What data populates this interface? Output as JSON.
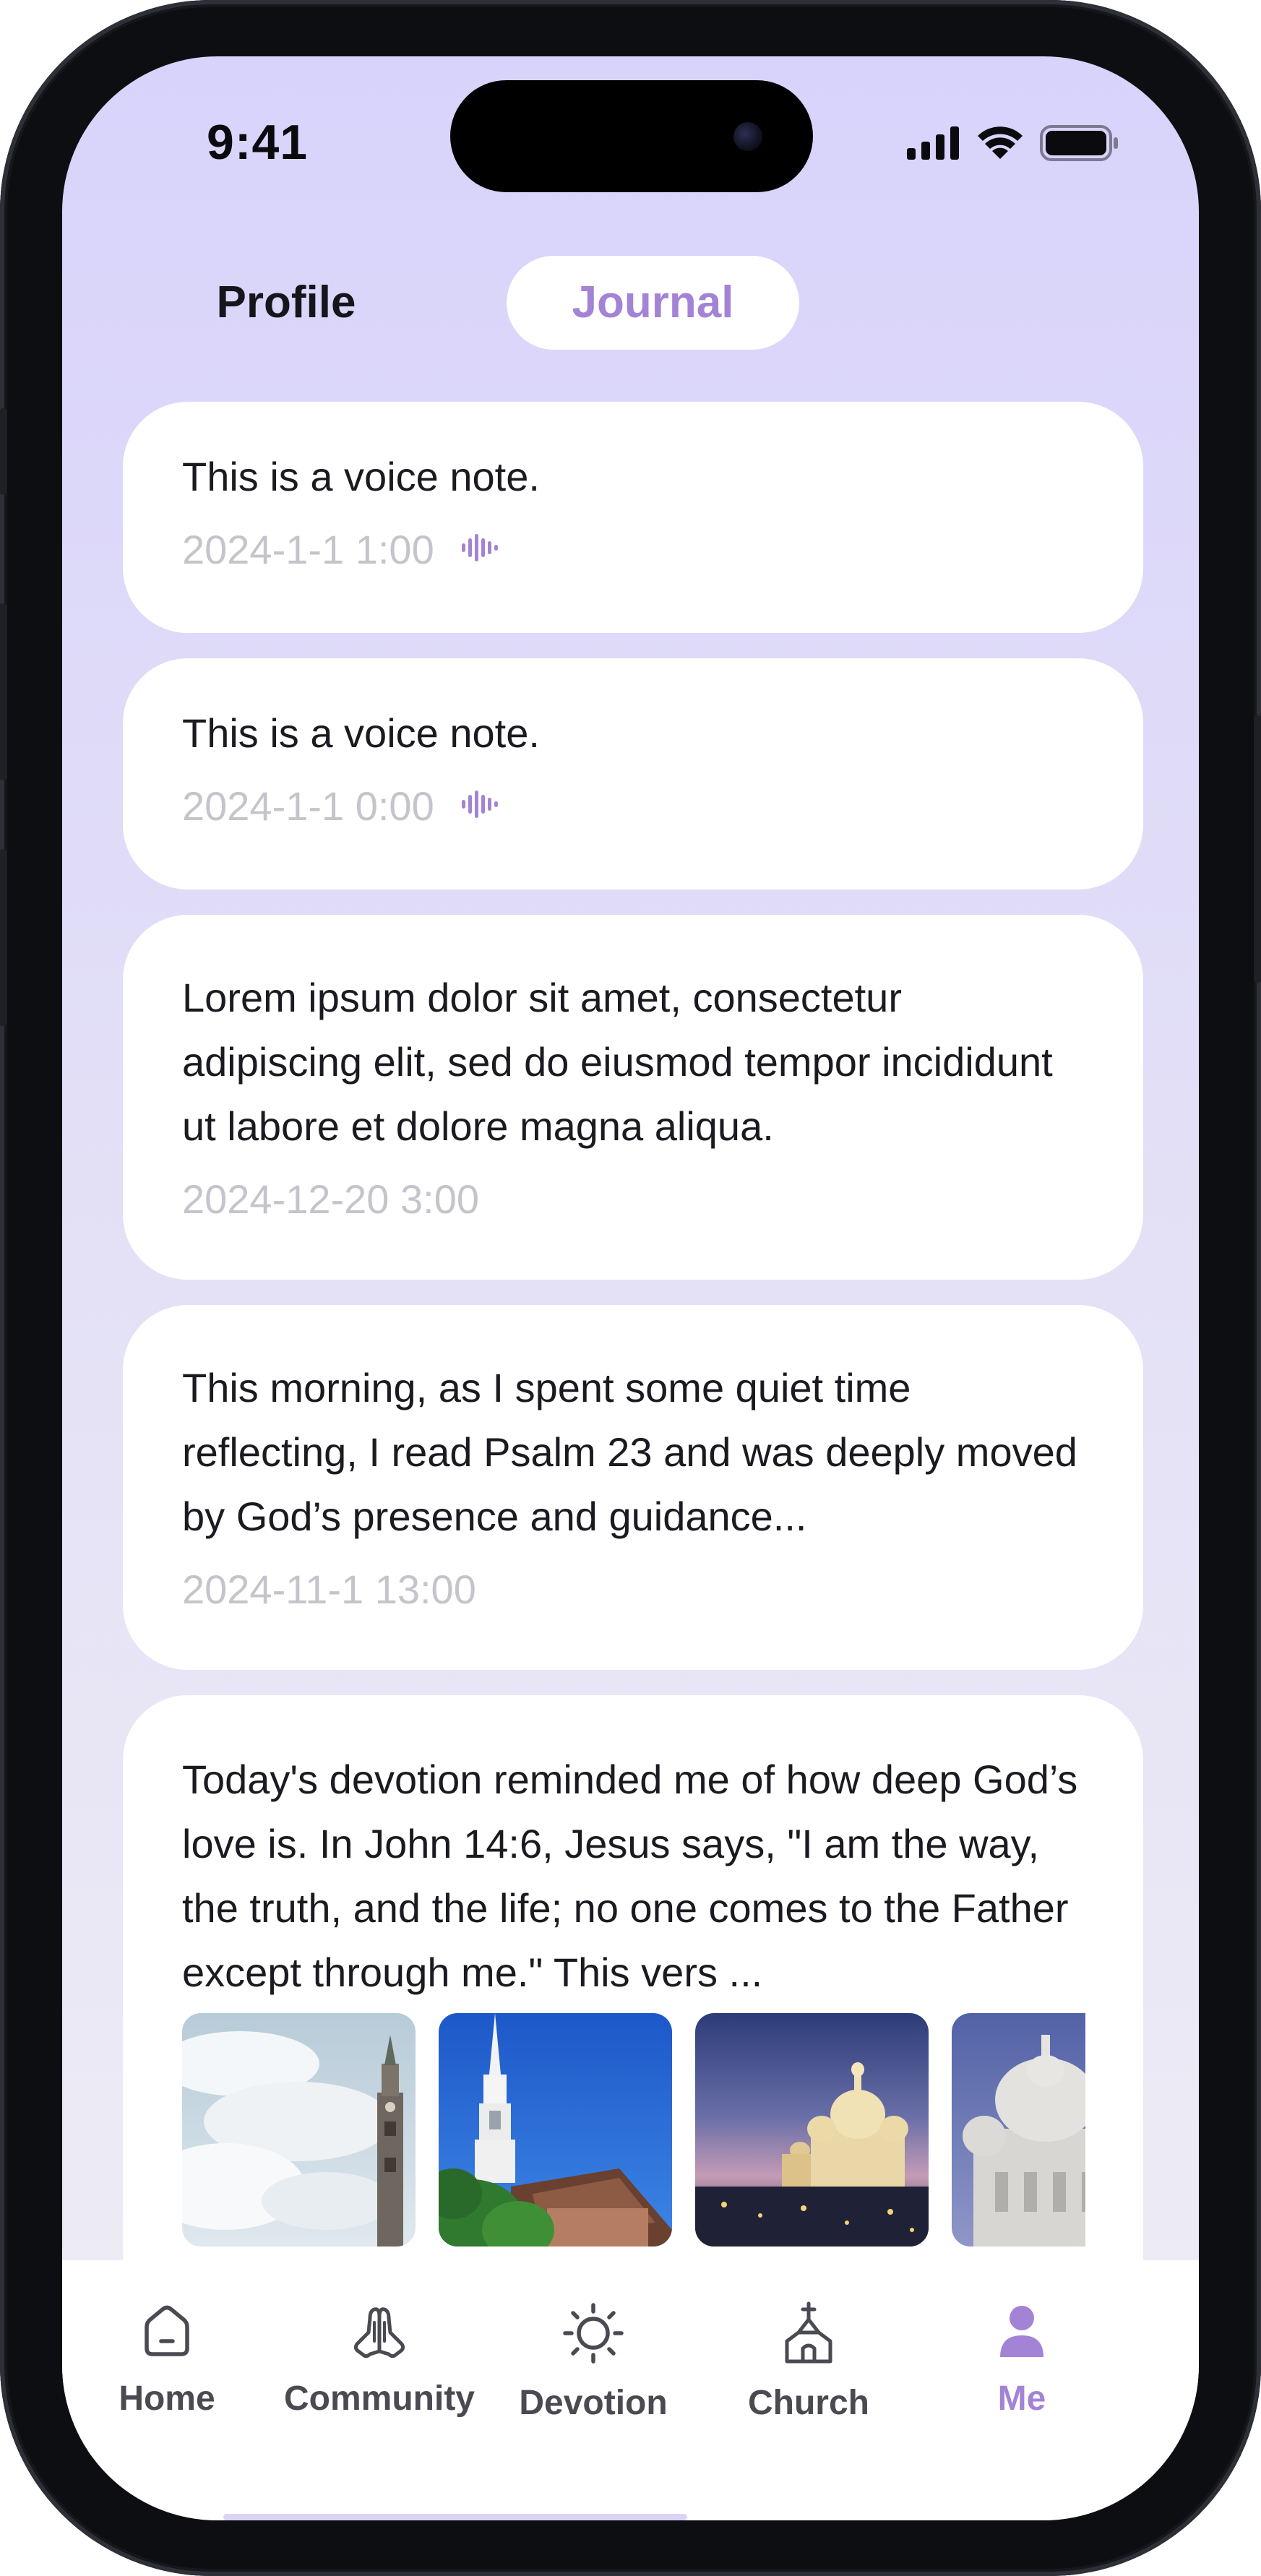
{
  "status_bar": {
    "time": "9:41"
  },
  "tabs": [
    {
      "label": "Profile",
      "active": false
    },
    {
      "label": "Journal",
      "active": true
    }
  ],
  "entries": [
    {
      "text": "This is a voice note.",
      "date": "2024-1-1 1:00",
      "has_voice": true
    },
    {
      "text": "This is a voice note.",
      "date": "2024-1-1 0:00",
      "has_voice": true
    },
    {
      "text": "Lorem ipsum dolor sit amet, consectetur adipiscing elit, sed do eiusmod tempor incididunt ut labore et dolore magna aliqua.",
      "date": "2024-12-20 3:00",
      "has_voice": false
    },
    {
      "text": "This morning, as I spent some quiet time reflecting, I read Psalm 23 and was deeply moved by God’s presence and guidance...",
      "date": "2024-11-1 13:00",
      "has_voice": false
    },
    {
      "text": "Today's devotion reminded me of how deep God’s love is. In John 14:6, Jesus says, \"I am the way, the truth, and the life; no one comes to the Father except through me.\" This vers ...",
      "date": "",
      "has_voice": false,
      "photos": [
        "church-tower-photo",
        "white-steeple-photo",
        "basilica-dusk-photo",
        "basilica-dome-photo"
      ]
    }
  ],
  "nav": [
    {
      "label": "Home",
      "icon": "home-icon",
      "active": false
    },
    {
      "label": "Community",
      "icon": "praying-hands-icon",
      "active": false
    },
    {
      "label": "Devotion",
      "icon": "sun-icon",
      "active": false
    },
    {
      "label": "Church",
      "icon": "church-icon",
      "active": false
    },
    {
      "label": "Me",
      "icon": "person-icon",
      "active": true
    }
  ],
  "colors": {
    "accent": "#a383d6",
    "bg_top": "#d8d3fb",
    "bg_bottom": "#efeef4",
    "card": "#ffffff",
    "date_text": "#c4c4cb",
    "nav_text": "#4a4a52"
  }
}
